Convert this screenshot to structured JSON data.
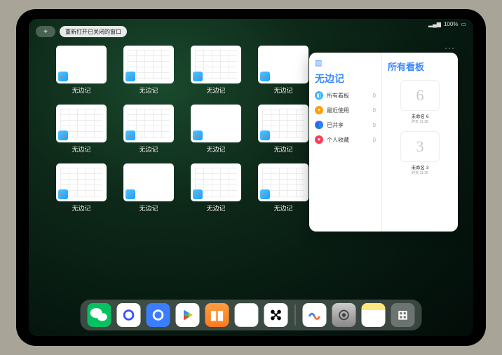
{
  "status": {
    "signal": "▂▄▆",
    "battery": "100%"
  },
  "topbar": {
    "plus": "+",
    "reopen_label": "重新打开已关闭的窗口"
  },
  "thumbs": [
    {
      "label": "无边记",
      "variant": "blank"
    },
    {
      "label": "无边记",
      "variant": "calendar"
    },
    {
      "label": "无边记",
      "variant": "calendar"
    },
    {
      "label": "无边记",
      "variant": "blank"
    },
    {
      "label": "无边记",
      "variant": "calendar"
    },
    {
      "label": "无边记",
      "variant": "calendar"
    },
    {
      "label": "无边记",
      "variant": "blank"
    },
    {
      "label": "无边记",
      "variant": "calendar"
    },
    {
      "label": "无边记",
      "variant": "calendar"
    },
    {
      "label": "无边记",
      "variant": "blank"
    },
    {
      "label": "无边记",
      "variant": "calendar"
    },
    {
      "label": "无边记",
      "variant": "calendar"
    }
  ],
  "panel": {
    "more": "···",
    "left_title": "无边记",
    "menu": [
      {
        "icon_color": "blue",
        "glyph": "◧",
        "label": "所有看板",
        "count": "0"
      },
      {
        "icon_color": "orange",
        "glyph": "✦",
        "label": "最近使用",
        "count": "0"
      },
      {
        "icon_color": "indigo",
        "glyph": "👥",
        "label": "已共享",
        "count": "0"
      },
      {
        "icon_color": "red",
        "glyph": "♥",
        "label": "个人收藏",
        "count": "0"
      }
    ],
    "right_title": "所有看板",
    "boards": [
      {
        "sketch": "6",
        "label": "未命名 6",
        "sub": "昨天 11:28"
      },
      {
        "sketch": "3",
        "label": "未命名 3",
        "sub": "昨天 11:25"
      }
    ]
  },
  "dock": {
    "apps": [
      {
        "name": "wechat",
        "glyph": "✦"
      },
      {
        "name": "quark1",
        "glyph": "◯"
      },
      {
        "name": "quark2",
        "glyph": "◯"
      },
      {
        "name": "play",
        "glyph": "▶"
      },
      {
        "name": "books",
        "glyph": "▮▮"
      },
      {
        "name": "dice",
        "glyph": "⊡"
      },
      {
        "name": "xshape",
        "glyph": "✖"
      }
    ],
    "recent": [
      {
        "name": "freeform",
        "glyph": "〰"
      },
      {
        "name": "settings",
        "glyph": "⚙"
      },
      {
        "name": "notes",
        "glyph": ""
      },
      {
        "name": "folder",
        "glyph": "⊞"
      }
    ]
  }
}
